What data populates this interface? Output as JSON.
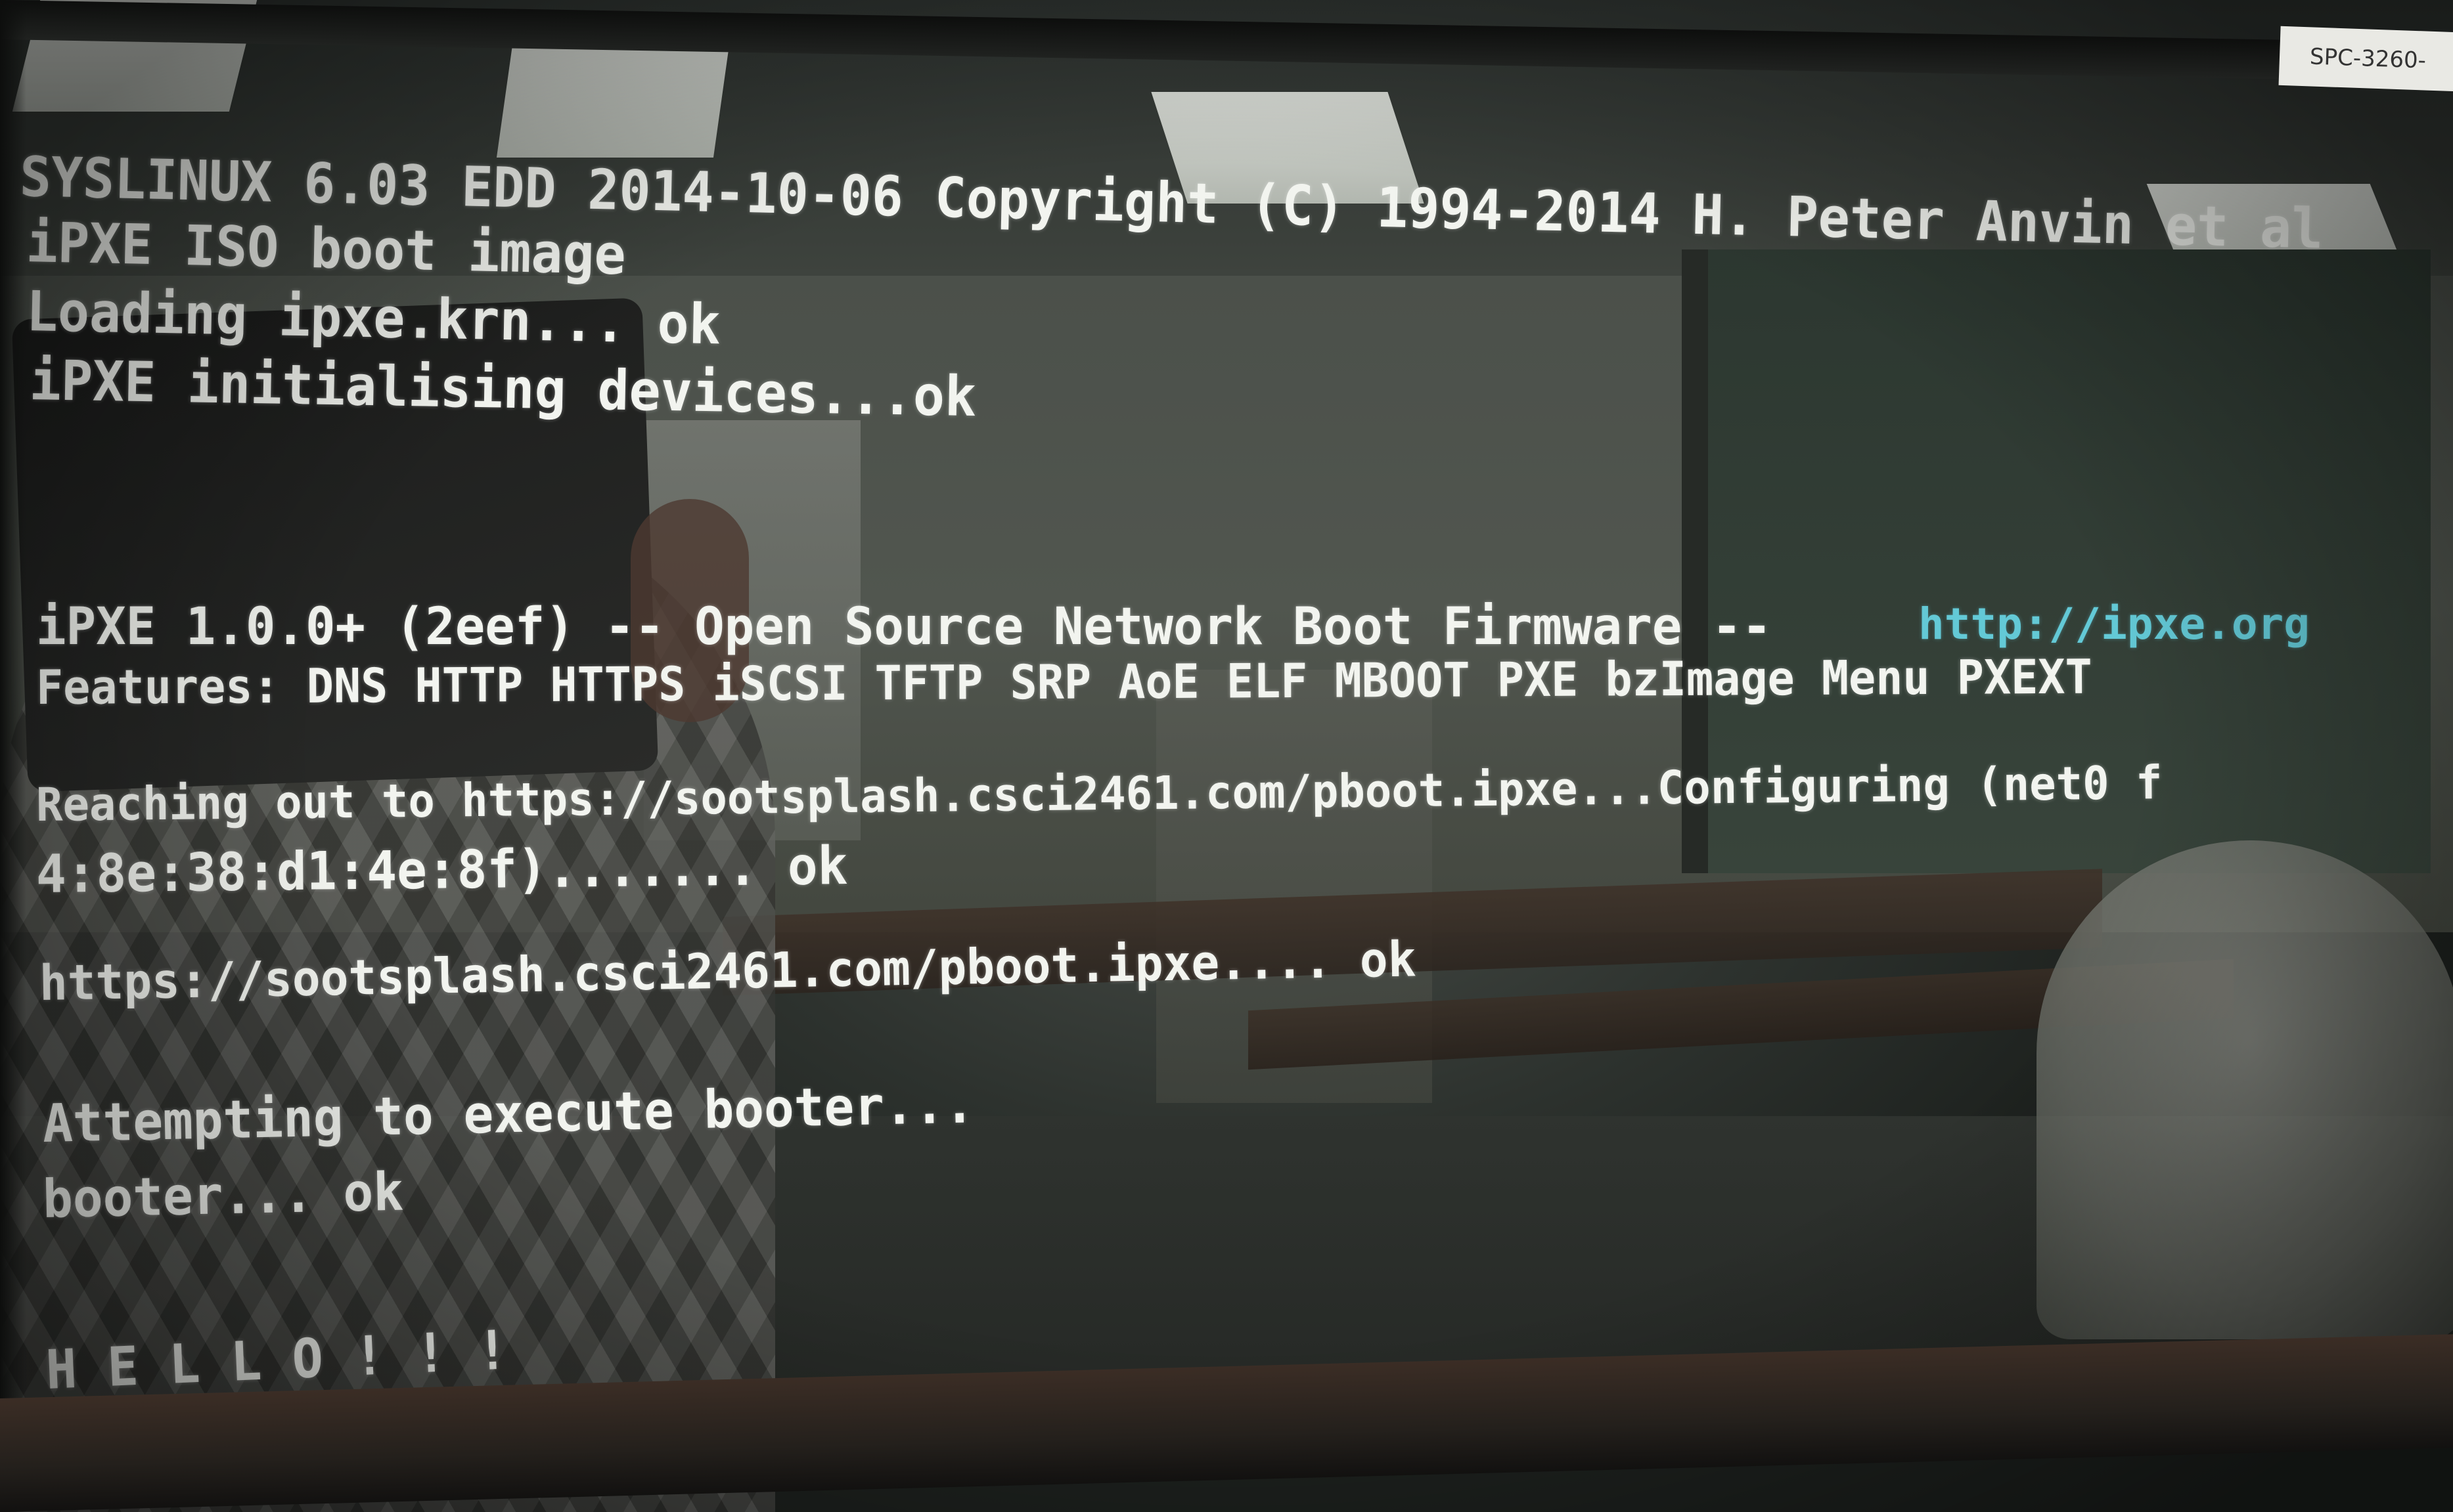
{
  "monitor_label": "SPC-3260-",
  "terminal": {
    "lines": [
      "SYSLINUX 6.03 EDD 2014-10-06 Copyright (C) 1994-2014 H. Peter Anvin et al",
      "iPXE ISO boot image",
      "Loading ipxe.krn... ok",
      "iPXE initialising devices...ok",
      "iPXE 1.0.0+ (2eef) -- Open Source Network Boot Firmware -- ",
      "http://ipxe.org",
      "Features: DNS HTTP HTTPS iSCSI TFTP SRP AoE ELF MBOOT PXE bzImage Menu PXEXT",
      "Reaching out to https://sootsplash.csci2461.com/pboot.ipxe...Configuring (net0 f",
      "4:8e:38:d1:4e:8f)....... ok",
      "https://sootsplash.csci2461.com/pboot.ipxe.... ok",
      "Attempting to execute booter...",
      "booter... ok",
      "H E L L O ! ! !"
    ]
  },
  "colors": {
    "text": "#f2f4ef",
    "link": "#63c9d6"
  }
}
